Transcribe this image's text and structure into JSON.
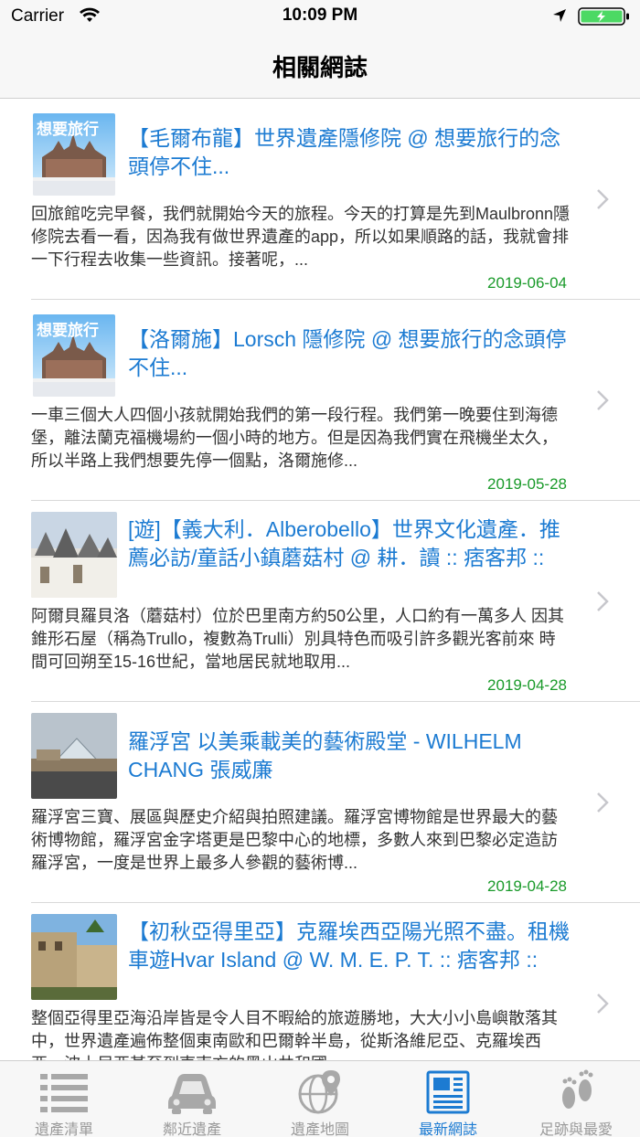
{
  "status_bar": {
    "carrier": "Carrier",
    "time": "10:09 PM"
  },
  "nav": {
    "title": "相關網誌"
  },
  "posts": [
    {
      "title": "【毛爾布龍】世界遺產隱修院 @ 想要旅行的念頭停不住...",
      "excerpt": "回旅館吃完早餐，我們就開始今天的旅程。今天的打算是先到Maulbronn隱修院去看一看，因為我有做世界遺產的app，所以如果順路的話，我就會排一下行程去收集一些資訊。接著呢，...",
      "date": "2019-06-04",
      "thumb_text": "想要旅行"
    },
    {
      "title": "【洛爾施】Lorsch 隱修院 @ 想要旅行的念頭停不住...",
      "excerpt": "一車三個大人四個小孩就開始我們的第一段行程。我們第一晚要住到海德堡，離法蘭克福機場約一個小時的地方。但是因為我們實在飛機坐太久，所以半路上我們想要先停一個點，洛爾施修...",
      "date": "2019-05-28",
      "thumb_text": "想要旅行"
    },
    {
      "title": "[遊]【義大利．Alberobello】世界文化遺產．推薦必訪/童話小鎮蘑菇村 @ 耕．讀 :: 痞客邦 ::",
      "excerpt": "阿爾貝羅貝洛（蘑菇村）位於巴里南方約50公里，人口約有一萬多人 因其錐形石屋（稱為Trullo，複數為Trulli）別具特色而吸引許多觀光客前來 時間可回朔至15-16世紀，當地居民就地取用...",
      "date": "2019-04-28"
    },
    {
      "title": "羅浮宮 以美乘載美的藝術殿堂 - WILHELM CHANG 張威廉",
      "excerpt": "羅浮宮三寶、展區與歷史介紹與拍照建議。羅浮宮博物館是世界最大的藝術博物館，羅浮宮金字塔更是巴黎中心的地標，多數人來到巴黎必定造訪羅浮宮，一度是世界上最多人參觀的藝術博...",
      "date": "2019-04-28"
    },
    {
      "title": "【初秋亞得里亞】克羅埃西亞陽光照不盡。租機車遊Hvar Island @ W. M. E. P. T. :: 痞客邦 ::",
      "excerpt": "整個亞得里亞海沿岸皆是令人目不暇給的旅遊勝地，大大小小島嶼散落其中，世界遺產遍佈整個東南歐和巴爾幹半島，從斯洛維尼亞、克羅埃西亞、波士尼亞甚至到東南方的黑山共和國，一...",
      "date": ""
    }
  ],
  "tabs": [
    {
      "label": "遺產清單",
      "icon": "list-icon"
    },
    {
      "label": "鄰近遺產",
      "icon": "car-icon"
    },
    {
      "label": "遺產地圖",
      "icon": "globe-pin-icon"
    },
    {
      "label": "最新網誌",
      "icon": "newspaper-icon"
    },
    {
      "label": "足跡與最愛",
      "icon": "footprints-icon"
    }
  ],
  "colors": {
    "link_blue": "#1c7bd2",
    "date_green": "#1a9a2a",
    "battery_green": "#4cd964"
  }
}
